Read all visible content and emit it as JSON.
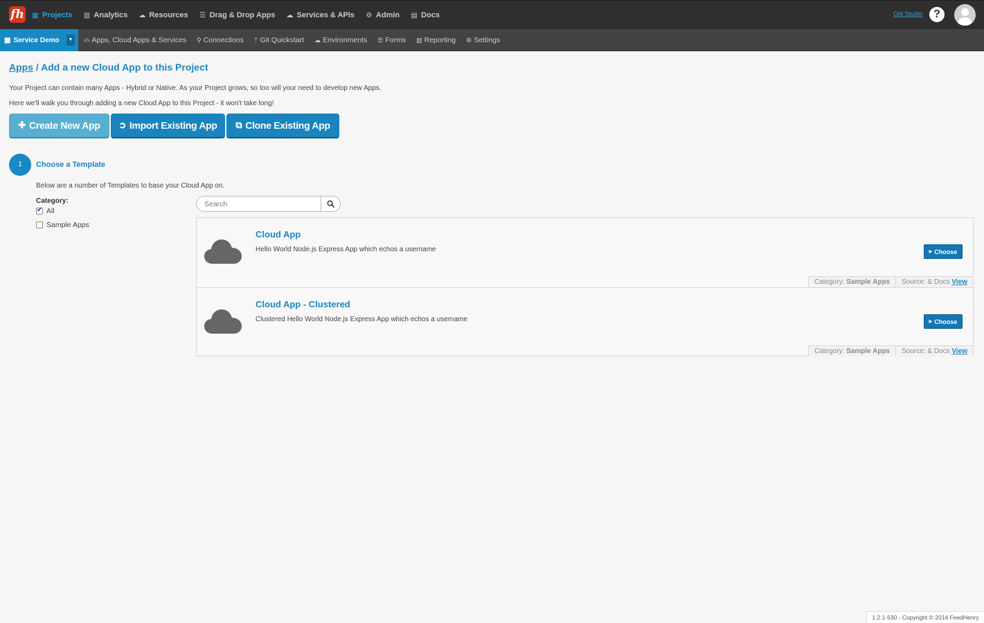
{
  "topnav": {
    "logo": "fh",
    "items": [
      {
        "label": "Projects",
        "icon": "grid-icon"
      },
      {
        "label": "Analytics",
        "icon": "bar-chart-icon"
      },
      {
        "label": "Resources",
        "icon": "cloud-icon"
      },
      {
        "label": "Drag & Drop Apps",
        "icon": "list-icon"
      },
      {
        "label": "Services & APIs",
        "icon": "cloud-upload-icon"
      },
      {
        "label": "Admin",
        "icon": "cogs-icon"
      },
      {
        "label": "Docs",
        "icon": "book-icon"
      }
    ],
    "old_studio": "Old Studio",
    "help": "?"
  },
  "subnav": {
    "project": "Service Demo",
    "items": [
      {
        "label": "Apps, Cloud Apps & Services",
        "icon": "code-icon"
      },
      {
        "label": "Connections",
        "icon": "sitemap-icon"
      },
      {
        "label": "Git Quickstart",
        "icon": "branch-icon"
      },
      {
        "label": "Environments",
        "icon": "cloud-icon"
      },
      {
        "label": "Forms",
        "icon": "list-icon"
      },
      {
        "label": "Reporting",
        "icon": "bar-chart-icon"
      },
      {
        "label": "Settings",
        "icon": "cogs-icon"
      }
    ]
  },
  "main": {
    "breadcrumb_link": "Apps",
    "title_rest": " / Add a new Cloud App to this Project",
    "intro1": "Your Project can contain many Apps - Hybrid or Native. As your Project grows, so too will your need to develop new Apps.",
    "intro2": "Here we'll walk you through adding a new Cloud App to this Project - it won't take long!",
    "buttons": {
      "create": "Create New App",
      "import": "Import Existing App",
      "clone": "Clone Existing App"
    },
    "step": {
      "number": "1",
      "title": "Choose a Template",
      "description": "Below are a number of Templates to base your Cloud App on."
    },
    "category": {
      "label": "Category:",
      "options": [
        {
          "label": "All",
          "checked": true
        },
        {
          "label": "Sample Apps",
          "checked": false
        }
      ]
    },
    "search": {
      "placeholder": "Search",
      "value": ""
    },
    "templates": [
      {
        "name": "Cloud App",
        "description": "Hello World Node.js Express App which echos a username",
        "choose": "Choose",
        "category_label": "Category:",
        "category": "Sample Apps",
        "source_label": "Source: & Docs",
        "view": "View"
      },
      {
        "name": "Cloud App - Clustered",
        "description": "Clustered Hello World Node.js Express App which echos a username",
        "choose": "Choose",
        "category_label": "Category:",
        "category": "Sample Apps",
        "source_label": "Source: & Docs",
        "view": "View"
      }
    ]
  },
  "footer": "1.2.1-530 - Copyright © 2014 FeedHenry",
  "colors": {
    "accent": "#1789c4",
    "topbar": "#2f2f2f",
    "subbar": "#434343",
    "brand_red": "#d9351f",
    "cloud_gray": "#666666"
  }
}
